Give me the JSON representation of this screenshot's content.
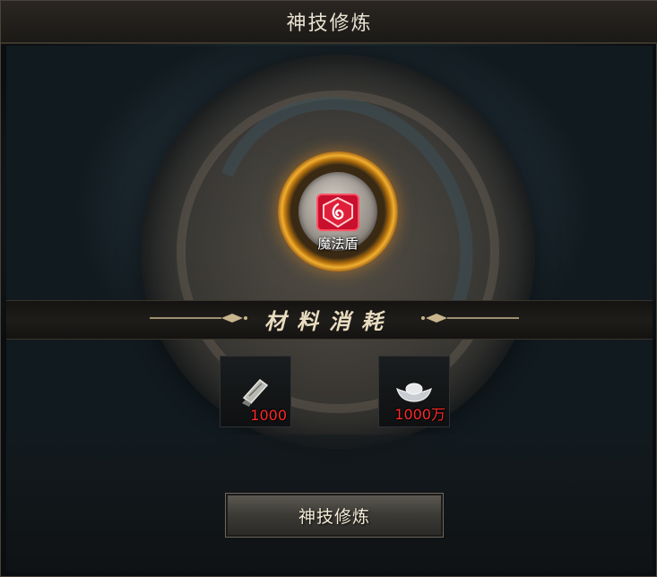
{
  "window": {
    "title": "神技修炼"
  },
  "skill": {
    "name": "魔法盾",
    "icon": "shield-rune-icon"
  },
  "materials": {
    "title": "材料消耗",
    "items": [
      {
        "icon": "scroll-book-icon",
        "count": "1000"
      },
      {
        "icon": "silver-ingot-icon",
        "count": "1000万"
      }
    ]
  },
  "actions": {
    "train_label": "神技修炼"
  },
  "colors": {
    "count_text": "#ff2a2a",
    "orb_glow": "#f0b030",
    "title_text": "#e9e3d2"
  }
}
